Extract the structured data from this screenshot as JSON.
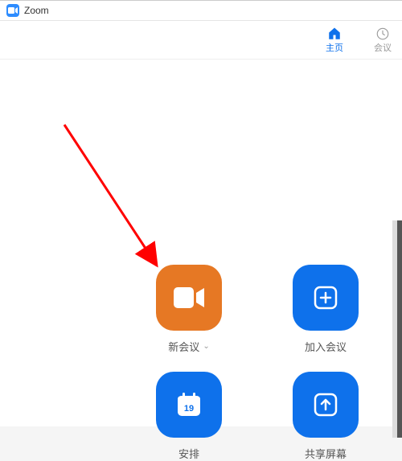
{
  "titlebar": {
    "app_name": "Zoom"
  },
  "nav": {
    "home": {
      "label": "主页"
    },
    "meetings": {
      "label": "会议"
    }
  },
  "tiles": {
    "new_meeting": {
      "label": "新会议"
    },
    "join": {
      "label": "加入会议"
    },
    "schedule": {
      "label": "安排",
      "calendar_day": "19"
    },
    "share": {
      "label": "共享屏幕"
    }
  },
  "colors": {
    "orange": "#e67824",
    "blue": "#0e71eb"
  }
}
